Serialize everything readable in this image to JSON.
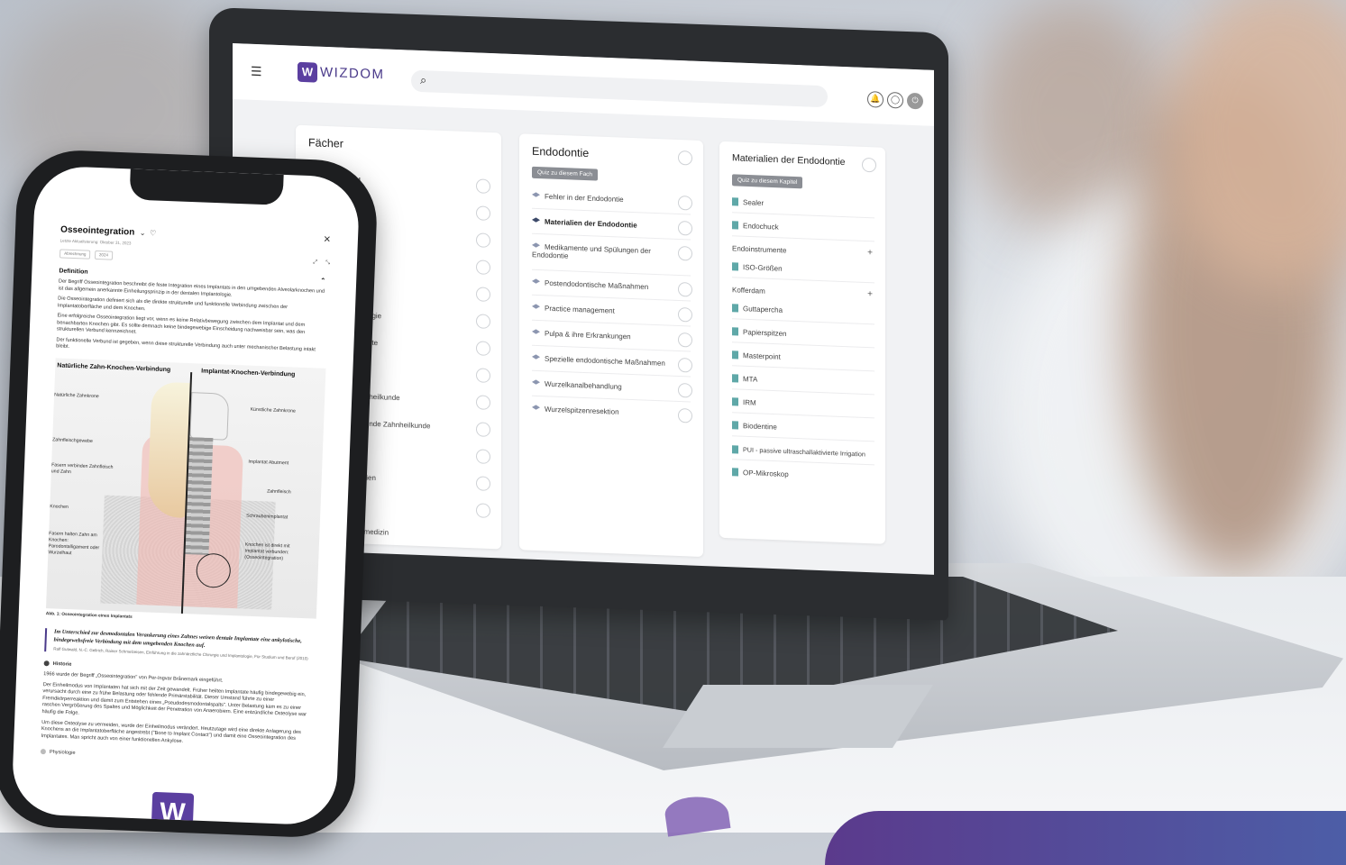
{
  "app": {
    "logo_letter": "W",
    "name": "WIZDOM",
    "accent_color": "#5b3fa0",
    "header_icons": [
      "menu-icon",
      "search-icon",
      "bell-icon",
      "user-icon",
      "power-icon"
    ]
  },
  "faecher_panel": {
    "title": "Fächer",
    "visible_items": [
      "AM",
      "ogie",
      "nte",
      "ahnheilkunde",
      "ierende Zahnheilkunde",
      "alien",
      "llmedizin"
    ]
  },
  "endodontie_panel": {
    "title": "Endodontie",
    "quiz_label": "Quiz zu diesem Fach",
    "items": [
      "Fehler in der Endodontie",
      "Materialien der Endodontie",
      "Medikamente und Spülungen der Endodontie",
      "Postendodontische Maßnahmen",
      "Practice management",
      "Pulpa & ihre Erkrankungen",
      "Spezielle endodontische Maßnahmen",
      "Wurzelkanalbehandlung",
      "Wurzelspitzenresektion"
    ]
  },
  "materialien_panel": {
    "title": "Materialien der Endodontie",
    "quiz_label": "Quiz zu diesem Kapitel",
    "items_top": [
      "Sealer",
      "Endochuck"
    ],
    "group1": "Endoinstrumente",
    "group1_items": [
      "ISO-Größen"
    ],
    "group2": "Kofferdam",
    "group2_items": [
      "Guttapercha",
      "Papierspitzen",
      "Masterpoint",
      "MTA",
      "IRM",
      "Biodentine",
      "PUI - passive ultraschallaktivierte Irrigation",
      "OP-Mikroskop"
    ]
  },
  "phone_doc": {
    "title": "Osseointegration",
    "updated": "Letzte Aktualisierung: Oktober 31, 2023",
    "chip1": "Abrechnung",
    "chip2": "2024",
    "section": "Definition",
    "p1": "Der Begriff Osseointegration beschreibt die feste Integration eines Implantats in den umgebenden Alveolarknochen und ist das allgemein anerkannte Einheilungsprinzip in der dentalen Implantologie.",
    "p2": "Die Osseointegration definiert sich als die direkte strukturelle und funktionelle Verbindung zwischen der Implantatoberfläche und dem Knochen.",
    "p3": "Eine erfolgreiche Osseointegration liegt vor, wenn es keine Relativbewegung zwischen dem Implantat und dem benachbarten Knochen gibt. Es sollte demnach keine bindegewebige Einscheidung nachweisbar sein, was den strukturellen Verbund kennzeichnet.",
    "p4": "Der funktionelle Verbund ist gegeben, wenn diese strukturelle Verbindung auch unter mechanischer Belastung intakt bleibt.",
    "figure": {
      "left_heading": "Natürliche Zahn-Knochen-Verbindung",
      "right_heading": "Implantat-Knochen-Verbindung",
      "left_labels": [
        "Natürliche Zahnkrone",
        "Zahnfleischgewebe",
        "Fasern verbinden Zahnfleisch und Zahn",
        "Knochen",
        "Fasern halten Zahn am Knochen: Parodontalligament oder Wurzelhaut"
      ],
      "right_labels": [
        "Künstliche Zahnkrone",
        "Implantat Abutment",
        "Zahnfleisch",
        "Schraubenimplantat",
        "Knochen ist direkt mit Implantat verbunden: (Osseointegration)"
      ],
      "caption": "Abb. 1: Osseointegration eines Implantats"
    },
    "quote": "Im Unterschied zur desmodontalen Verankerung eines Zahnes weisen dentale Implantate eine ankylotische, bindegewebsfreie Verbindung mit dem umgebenden Knochen auf.",
    "quote_src": "Ralf Gutwald, N.-C. Gellrich, Rainer Schmelzeisen, Einführung in die zahnärztliche Chirurgie und Implantologie, Für Studium und Beruf (2010)",
    "historie": "Historie",
    "h1": "1966 wurde der Begriff „Osseointegration\" von Per-Ingvar Brånemark eingeführt.",
    "h2": "Der Einheilmodus von Implantaten hat sich mit der Zeit gewandelt. Früher heilten Implantate häufig bindegewebig ein, verursacht durch eine zu frühe Belastung oder fehlende Primärstabilität. Dieser Umstand führte zu einer Fremdkörperreaktion und damit zum Entstehen eines „Pseudodesmodontalspalts\". Unter Belastung kam es zu einer raschen Vergrößerung des Spaltes und Möglichkeit der Penetration von Anaerobiern. Eine entzündliche Osteolyse war häufig die Folge.",
    "h3": "Um diese Osteolyse zu vermeiden, wurde der Einheilmodus verändert. Heutzutage wird eine direkte Anlagerung des Knochens an die Implantatoberfläche angestrebt (\"Bone to Implant Contact\") und damit eine Osseointegration des Implantates. Man spricht auch von einer funktionellen Ankylose.",
    "physiologie": "Physiologie"
  }
}
